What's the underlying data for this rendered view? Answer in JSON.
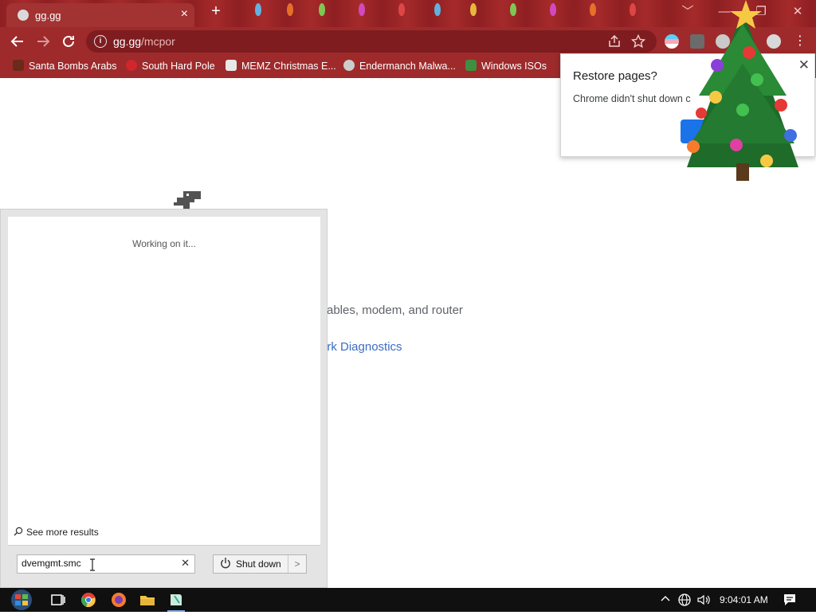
{
  "browser": {
    "tab_title": "gg.gg",
    "tab_close": "×",
    "new_tab": "+",
    "url_host": "gg.gg",
    "url_path": "/mcpor",
    "info_glyph": "i",
    "window_controls": [
      "﹀",
      "—",
      "❐",
      "✕"
    ]
  },
  "bookmarks": [
    {
      "label": "Santa Bombs Arabs",
      "icon": "santa-icon",
      "color": "#4a2a1a"
    },
    {
      "label": "South Hard Pole",
      "icon": "snowflake-icon",
      "color": "#d0262e"
    },
    {
      "label": "MEMZ Christmas E...",
      "icon": "memz-icon",
      "color": "#e8e8e8"
    },
    {
      "label": "Endermanch Malwa...",
      "icon": "raccoon-icon",
      "color": "#cccccc"
    },
    {
      "label": "Windows ISOs",
      "icon": "tree-icon",
      "color": "#3f8f3f"
    }
  ],
  "restore_popup": {
    "title": "Restore pages?",
    "message": "Chrome didn't shut down c",
    "close": "✕"
  },
  "page": {
    "text_fragment": "ables, modem, and router",
    "link_fragment": "ork Diagnostics"
  },
  "start_panel": {
    "status": "Working on it...",
    "see_more": "See more results",
    "search_value": "dvemgmt.smc",
    "clear_glyph": "✕",
    "shutdown_label": "Shut down",
    "shutdown_arrow": ">"
  },
  "taskbar": {
    "clock": "9:04:01 AM",
    "tray_glyphs": {
      "chevron": "^",
      "globe": "⊕",
      "speaker": "🔊"
    }
  },
  "colors": {
    "chrome_theme": "#9e2a2b",
    "link": "#3b6cc4",
    "button_blue": "#1a73e8",
    "taskbar": "#101010"
  }
}
